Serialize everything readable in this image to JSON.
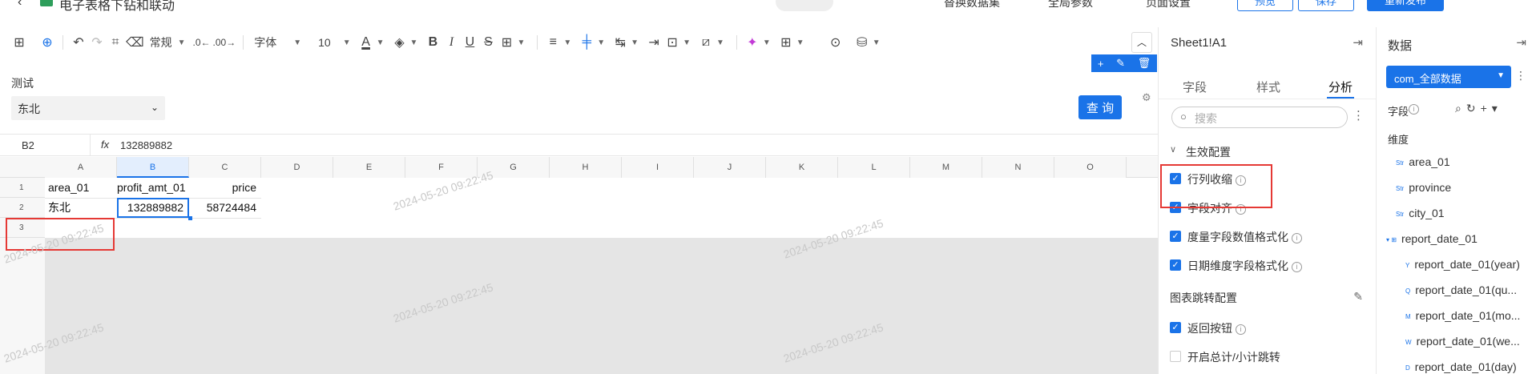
{
  "topbar": {
    "file_title": "电子表格下钻和联动",
    "replace_data": "替换数据集",
    "global_params": "全局参数",
    "page_settings": "页面设置",
    "preview": "预览",
    "save": "保存",
    "republish": "重新发布"
  },
  "toolbar": {
    "number_format": "常规",
    "font_family": "字体",
    "font_size": "10",
    "font_color_letter": "A"
  },
  "filter": {
    "label": "测试",
    "value": "东北",
    "query_button": "查 询"
  },
  "formula_bar": {
    "cell_ref": "B2",
    "fx": "fx",
    "value": "132889882"
  },
  "columns": [
    "A",
    "B",
    "C",
    "D",
    "E",
    "F",
    "G",
    "H",
    "I",
    "J",
    "K",
    "L",
    "M",
    "N",
    "O"
  ],
  "rows": [
    "1",
    "2",
    "3"
  ],
  "cells": {
    "A1": "area_01",
    "B1": "profit_amt_01",
    "C1": "price",
    "A2": "东北",
    "B2": "132889882",
    "C2": "58724484"
  },
  "watermark": "2024-05-20 09:22:45",
  "middle_panel": {
    "sheet_ref": "Sheet1!A1",
    "tabs": [
      "字段",
      "样式",
      "分析"
    ],
    "active_tab": "分析",
    "search_placeholder": "搜索",
    "section_title": "生效配置",
    "options": [
      {
        "label": "行列收缩",
        "checked": true
      },
      {
        "label": "字段对齐",
        "checked": true
      },
      {
        "label": "度量字段数值格式化",
        "checked": true
      },
      {
        "label": "日期维度字段格式化",
        "checked": true
      }
    ],
    "jump_title": "图表跳转配置",
    "jump_options": [
      {
        "label": "返回按钮",
        "checked": true
      },
      {
        "label": "开启总计/小计跳转",
        "checked": false
      }
    ]
  },
  "right_panel": {
    "title": "数据",
    "dataset": "com_全部数据",
    "fields_label": "字段",
    "dimension_label": "维度",
    "fields": [
      {
        "tag": "Str",
        "name": "area_01",
        "indent": 0
      },
      {
        "tag": "Str",
        "name": "province",
        "indent": 0
      },
      {
        "tag": "Str",
        "name": "city_01",
        "indent": 0
      },
      {
        "tag": "▾ ⊞",
        "name": "report_date_01",
        "indent": -1
      },
      {
        "tag": "Y",
        "name": "report_date_01(year)",
        "indent": 1
      },
      {
        "tag": "Q",
        "name": "report_date_01(qu...",
        "indent": 1
      },
      {
        "tag": "M",
        "name": "report_date_01(mo...",
        "indent": 1
      },
      {
        "tag": "W",
        "name": "report_date_01(we...",
        "indent": 1
      },
      {
        "tag": "D",
        "name": "report_date_01(day)",
        "indent": 1
      }
    ]
  }
}
